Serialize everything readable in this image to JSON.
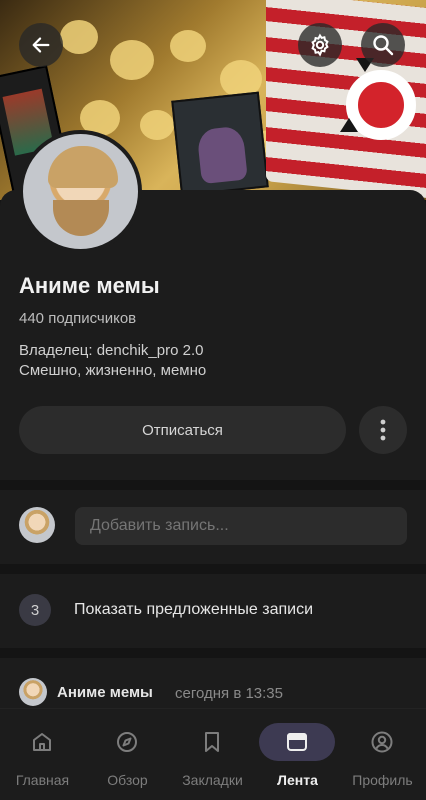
{
  "header": {
    "back_icon": "arrow-left-icon",
    "settings_icon": "gear-icon",
    "search_icon": "search-icon"
  },
  "community": {
    "title": "Аниме мемы",
    "subscribers": "440 подписчиков",
    "owner": "Владелец: denchik_pro 2.0",
    "description": "Смешно, жизненно, мемно",
    "unsubscribe_label": "Отписаться",
    "more_icon": "more-vertical-icon"
  },
  "composer": {
    "placeholder": "Добавить запись..."
  },
  "suggested": {
    "count": "3",
    "label": "Показать предложенные записи"
  },
  "post": {
    "author": "Аниме мемы",
    "time": "сегодня в 13:35"
  },
  "nav": {
    "items": [
      {
        "label": "Главная",
        "icon": "home-icon"
      },
      {
        "label": "Обзор",
        "icon": "compass-icon"
      },
      {
        "label": "Закладки",
        "icon": "bookmark-icon"
      },
      {
        "label": "Лента",
        "icon": "feed-icon"
      },
      {
        "label": "Профиль",
        "icon": "profile-icon"
      }
    ]
  },
  "colors": {
    "background": "#141414",
    "surface": "#1c1c1c",
    "button": "#2c2c2c",
    "active_pill": "#3d3a52"
  }
}
